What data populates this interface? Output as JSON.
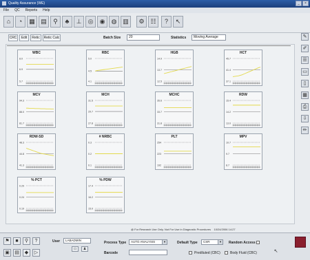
{
  "window": {
    "title": "Quality Assurance (WE)",
    "menus": [
      "File",
      "QC",
      "Reports",
      "Help"
    ]
  },
  "options": {
    "tabs": [
      "CRC",
      "Edit",
      "Retic",
      "Retic Calc"
    ],
    "batch_size_label": "Batch Size",
    "batch_size_value": "20",
    "statistics_label": "Statistics",
    "statistics_value": "Moving Average"
  },
  "chart_data": [
    {
      "type": "line",
      "title": "WBC",
      "yticks": [
        "8.0",
        "6.9",
        "5.7"
      ],
      "ylim": [
        5.7,
        8.0
      ],
      "series": [
        {
          "values": [
            7.4,
            7.4,
            7.4,
            7.4,
            7.4,
            7.4,
            7.4,
            7.4,
            7.4,
            7.4,
            7.4,
            7.4,
            7.4,
            7.4,
            7.4,
            7.4
          ]
        }
      ]
    },
    {
      "type": "line",
      "title": "RBC",
      "yticks": [
        "5.0",
        "4.5",
        "4.1"
      ],
      "ylim": [
        4.1,
        5.0
      ],
      "series": [
        {
          "values": [
            4.5,
            4.52,
            4.53,
            4.54,
            4.55,
            4.56,
            4.57,
            4.58,
            4.59,
            4.6,
            4.61,
            4.62,
            4.63,
            4.64,
            4.65,
            4.66
          ]
        }
      ]
    },
    {
      "type": "line",
      "title": "HGB",
      "yticks": [
        "14.9",
        "13.7",
        "12.5"
      ],
      "ylim": [
        12.5,
        14.9
      ],
      "series": [
        {
          "values": [
            13.3,
            13.35,
            13.4,
            13.45,
            13.5,
            13.55,
            13.6,
            13.65,
            13.7,
            13.75,
            13.8,
            13.85,
            13.9,
            13.95,
            14.0,
            14.05
          ]
        }
      ]
    },
    {
      "type": "line",
      "title": "HCT",
      "yticks": [
        "45.7",
        "41.4",
        "37.1"
      ],
      "ylim": [
        37.1,
        45.7
      ],
      "series": [
        {
          "values": [
            38.8,
            38.9,
            39.0,
            39.1,
            39.3,
            39.5,
            39.8,
            40.1,
            40.4,
            40.7,
            41.0,
            41.3,
            41.6,
            41.9,
            42.2,
            42.4
          ]
        }
      ]
    },
    {
      "type": "line",
      "title": "MCV",
      "yticks": [
        "94.3",
        "88.0",
        "81.7"
      ],
      "ylim": [
        81.7,
        94.3
      ],
      "series": [
        {
          "values": [
            90.0,
            90.0,
            89.9,
            89.9,
            89.9,
            89.8,
            89.8,
            89.8,
            89.7,
            89.7,
            89.7,
            89.6,
            89.6,
            89.6,
            89.5,
            89.5
          ]
        }
      ]
    },
    {
      "type": "line",
      "title": "MCH",
      "yticks": [
        "31.5",
        "29.7",
        "27.8"
      ],
      "ylim": [
        27.8,
        31.5
      ],
      "series": [
        {
          "values": [
            30.6,
            30.6,
            30.6,
            30.6,
            30.6,
            30.6,
            30.6,
            30.6,
            30.6,
            30.6,
            30.6,
            30.6,
            30.6,
            30.6,
            30.6,
            30.6
          ]
        }
      ]
    },
    {
      "type": "line",
      "title": "MCHC",
      "yticks": [
        "35.6",
        "33.7",
        "31.8"
      ],
      "ylim": [
        31.8,
        35.6
      ],
      "series": [
        {
          "values": [
            34.4,
            34.4,
            34.4,
            34.4,
            34.4,
            34.4,
            34.4,
            34.4,
            34.4,
            34.4,
            34.4,
            34.4,
            34.4,
            34.4,
            34.4,
            34.4
          ]
        }
      ]
    },
    {
      "type": "line",
      "title": "RDW",
      "yticks": [
        "15.4",
        "14.2",
        "13.0"
      ],
      "ylim": [
        13.0,
        15.4
      ],
      "series": [
        {
          "values": [
            14.9,
            14.9,
            14.9,
            14.9,
            14.9,
            14.9,
            14.9,
            14.9,
            14.9,
            14.9,
            14.9,
            14.9,
            14.9,
            14.9,
            14.9,
            14.9
          ]
        }
      ]
    },
    {
      "type": "line",
      "title": "RDW-SD",
      "yticks": [
        "48.3",
        "44.8",
        "41.3"
      ],
      "ylim": [
        41.3,
        48.3
      ],
      "series": [
        {
          "values": [
            46.5,
            46.3,
            46.1,
            45.9,
            45.7,
            45.5,
            45.3,
            45.1,
            44.9,
            44.8,
            44.7,
            44.6,
            44.5,
            44.4,
            44.3,
            44.2
          ]
        }
      ]
    },
    {
      "type": "line",
      "title": "# NRBC",
      "yticks": [
        "0.3",
        "0.2",
        "0.1"
      ],
      "ylim": [
        0.1,
        0.3
      ],
      "series": [
        {
          "values": [
            0.2,
            0.2,
            0.2,
            0.2,
            0.2,
            0.2,
            0.2,
            0.2,
            0.2,
            0.2,
            0.2,
            0.2,
            0.2,
            0.2,
            0.2,
            0.2
          ]
        }
      ]
    },
    {
      "type": "line",
      "title": "PLT",
      "yticks": [
        "254",
        "223",
        "192"
      ],
      "ylim": [
        192,
        254
      ],
      "series": [
        {
          "values": [
            230,
            230,
            230,
            230,
            230,
            230,
            230,
            230,
            230,
            230,
            230,
            230,
            230,
            230,
            230,
            230
          ]
        }
      ]
    },
    {
      "type": "line",
      "title": "MPV",
      "yticks": [
        "10.7",
        "9.7",
        "8.7"
      ],
      "ylim": [
        8.7,
        10.7
      ],
      "series": [
        {
          "values": [
            10.3,
            10.3,
            10.3,
            10.3,
            10.3,
            10.3,
            10.3,
            10.3,
            10.3,
            10.3,
            10.3,
            10.3,
            10.3,
            10.3,
            10.3,
            10.3
          ]
        }
      ]
    },
    {
      "type": "line",
      "title": "% PCT",
      "yticks": [
        "0.29",
        "0.24",
        "0.19"
      ],
      "ylim": [
        0.19,
        0.29
      ],
      "series": [
        {
          "values": [
            0.26,
            0.26,
            0.26,
            0.26,
            0.26,
            0.26,
            0.26,
            0.26,
            0.26,
            0.26,
            0.26,
            0.26,
            0.26,
            0.26,
            0.26,
            0.26
          ]
        }
      ]
    },
    {
      "type": "line",
      "title": "% PDW",
      "yticks": [
        "17.4",
        "16.2",
        "15.0"
      ],
      "ylim": [
        15.0,
        17.4
      ],
      "series": [
        {
          "values": [
            16.7,
            16.7,
            16.7,
            16.7,
            16.7,
            16.7,
            16.7,
            16.7,
            16.7,
            16.7,
            16.7,
            16.7,
            16.7,
            16.7,
            16.7,
            16.7
          ]
        }
      ]
    }
  ],
  "colors": {
    "series_line": "#e3d94a",
    "grid_line": "#777777",
    "title_bar": "#2d5ea8"
  },
  "status": {
    "message": "@ For Research Use Only. Not For Use in Diagnostic Procedures",
    "datetime": "10/24/2006 14:27"
  },
  "bottom": {
    "user_label": "User",
    "user_value": "LABADMIN",
    "process_type_label": "Process Type",
    "process_type_value": "AUTO ANALYSIS",
    "default_type_label": "Default Type",
    "default_type_value": "CSR",
    "random_access_label": "Random Access",
    "barcode_label": "Barcode",
    "barcode_value": "",
    "preset_label": "Prediluted (CBC)",
    "body_fluid_label": "Body Fluid (CBC)"
  }
}
